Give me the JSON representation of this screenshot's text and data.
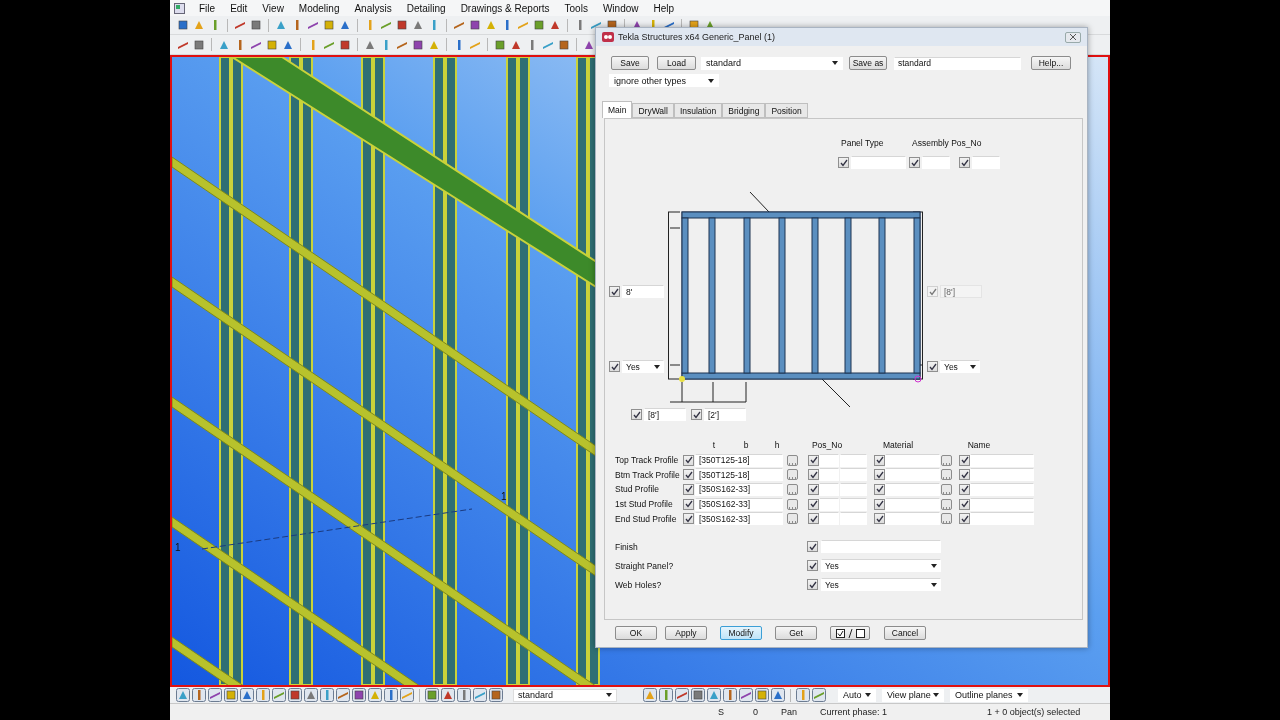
{
  "menu": [
    "File",
    "Edit",
    "View",
    "Modeling",
    "Analysis",
    "Detailing",
    "Drawings & Reports",
    "Tools",
    "Window",
    "Help"
  ],
  "viewport": {
    "grid_labels": [
      "1",
      "1"
    ]
  },
  "dialog": {
    "title": "Tekla Structures x64  Generic_Panel (1)",
    "save": "Save",
    "load": "Load",
    "attributes": "standard",
    "save_as": "Save as",
    "save_as_name": "standard",
    "help": "Help...",
    "filter": "ignore other types",
    "tabs": [
      {
        "label": "Main",
        "selected": true
      },
      {
        "label": "DryWall",
        "selected": false
      },
      {
        "label": "Insulation",
        "selected": false
      },
      {
        "label": "Bridging",
        "selected": false
      },
      {
        "label": "Position",
        "selected": false
      }
    ],
    "panel_type_label": "Panel Type",
    "assembly_label": "Assembly Pos_No",
    "top_checks": [
      {
        "checked": true
      },
      {
        "checked": true
      },
      {
        "checked": true
      }
    ],
    "diagram": {
      "height_left": {
        "checked": true,
        "disabled": false,
        "value": "8'"
      },
      "height_right": {
        "checked": true,
        "disabled": true,
        "value": "[8']"
      },
      "end_left": {
        "checked": true,
        "value": "Yes"
      },
      "end_right": {
        "checked": true,
        "value": "Yes"
      },
      "first_spacing": {
        "checked": true,
        "value": "[8']"
      },
      "spacing": {
        "checked": true,
        "value": "[2']"
      }
    },
    "profile_columns": [
      "t",
      "b",
      "h",
      "Pos_No",
      "Material",
      "Name"
    ],
    "profiles": [
      {
        "label": "Top Track Profile",
        "checked": true,
        "value": "[350T125-18]",
        "pos_checked": true,
        "material_checked": true,
        "name_checked": true
      },
      {
        "label": "Btm Track Profile",
        "checked": true,
        "value": "[350T125-18]",
        "pos_checked": true,
        "material_checked": true,
        "name_checked": true
      },
      {
        "label": "Stud Profile",
        "checked": true,
        "value": "[350S162-33]",
        "pos_checked": true,
        "material_checked": true,
        "name_checked": true
      },
      {
        "label": "1st Stud Profile",
        "checked": true,
        "value": "[350S162-33]",
        "pos_checked": true,
        "material_checked": true,
        "name_checked": true
      },
      {
        "label": "End Stud Profile",
        "checked": true,
        "value": "[350S162-33]",
        "pos_checked": true,
        "material_checked": true,
        "name_checked": true
      }
    ],
    "options": [
      {
        "kind": "field",
        "label": "Finish",
        "checked": true
      },
      {
        "kind": "select",
        "label": "Straight Panel?",
        "checked": true,
        "value": "Yes"
      },
      {
        "kind": "select",
        "label": "Web Holes?",
        "checked": true,
        "value": "Yes"
      }
    ],
    "buttons": [
      {
        "kind": "text",
        "label": "OK",
        "highlighted": false
      },
      {
        "kind": "text",
        "label": "Apply",
        "highlighted": false
      },
      {
        "kind": "text",
        "label": "Modify",
        "highlighted": true
      },
      {
        "kind": "text",
        "label": "Get",
        "highlighted": false
      },
      {
        "kind": "toggle",
        "highlighted": false
      },
      {
        "kind": "text",
        "label": "Cancel",
        "highlighted": false
      }
    ]
  },
  "bottom_toolbar": {
    "filter": "standard",
    "selects": [
      "Auto",
      "View plane",
      "Outline planes"
    ]
  },
  "status_bar": [
    "S",
    "0",
    "Pan",
    "Current phase: 1",
    "1 + 0 object(s) selected"
  ]
}
